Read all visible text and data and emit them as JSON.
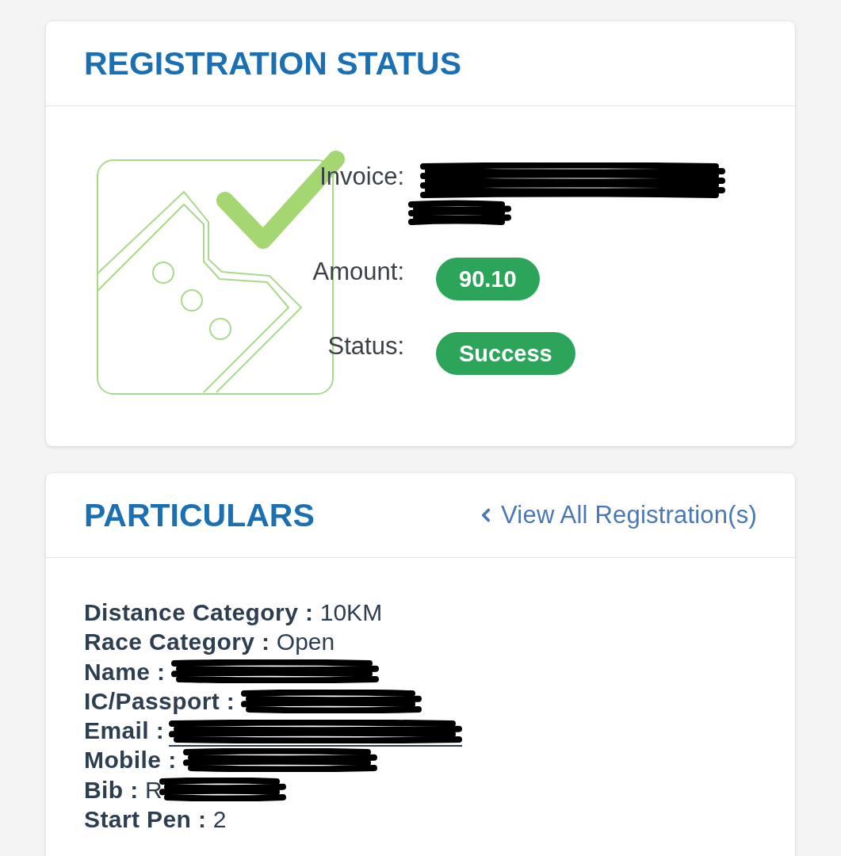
{
  "registration_status": {
    "title": "REGISTRATION STATUS",
    "fields": [
      {
        "kind": "text",
        "label": "Invoice:",
        "redacted": true
      },
      {
        "kind": "pill",
        "label": "Amount:",
        "value": "90.10",
        "redacted": false
      },
      {
        "kind": "pill",
        "label": "Status:",
        "value": "Success",
        "redacted": false
      }
    ]
  },
  "particulars": {
    "title": "PARTICULARS",
    "link": {
      "label": "View All Registration(s)"
    },
    "rows": [
      {
        "label": "Distance Category :",
        "value": "10KM",
        "redacted": false,
        "link": false
      },
      {
        "label": "Race Category :",
        "value": "Open",
        "redacted": false,
        "link": false
      },
      {
        "label": "Name :",
        "redacted": true,
        "link": false
      },
      {
        "label": "IC/Passport :",
        "redacted": true,
        "link": false
      },
      {
        "label": "Email :",
        "redacted": true,
        "link": true
      },
      {
        "label": "Mobile :",
        "redacted": true,
        "link": false
      },
      {
        "label": "Bib :",
        "value": "R",
        "redacted": true,
        "link": false
      },
      {
        "label": "Start Pen :",
        "value": "2",
        "redacted": false,
        "link": false
      }
    ]
  }
}
